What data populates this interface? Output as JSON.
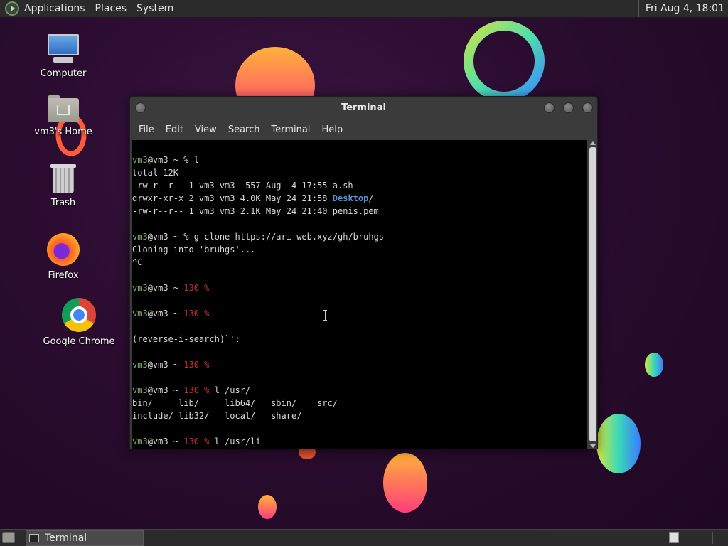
{
  "top_panel": {
    "menus": [
      "Applications",
      "Places",
      "System"
    ],
    "clock": "Fri Aug  4, 18:01"
  },
  "desktop_icons": [
    {
      "label": "Computer",
      "icon": "computer-icon"
    },
    {
      "label": "vm3's Home",
      "icon": "home-folder-icon"
    },
    {
      "label": "Trash",
      "icon": "trash-icon"
    },
    {
      "label": "Firefox",
      "icon": "firefox-icon"
    },
    {
      "label": "Google Chrome",
      "icon": "chrome-icon"
    }
  ],
  "terminal": {
    "title": "Terminal",
    "menus": [
      "File",
      "Edit",
      "View",
      "Search",
      "Terminal",
      "Help"
    ],
    "lines": [
      [
        {
          "t": "vm3",
          "c": "green"
        },
        {
          "t": "@vm3 ~ % l"
        }
      ],
      [
        {
          "t": "total 12K"
        }
      ],
      [
        {
          "t": "-rw-r--r-- 1 vm3 vm3  557 Aug  4 17:55 a.sh"
        }
      ],
      [
        {
          "t": "drwxr-xr-x 2 vm3 vm3 4.0K May 24 21:58 "
        },
        {
          "t": "Desktop",
          "c": "blue"
        },
        {
          "t": "/"
        }
      ],
      [
        {
          "t": "-rw-r--r-- 1 vm3 vm3 2.1K May 24 21:40 penis.pem"
        }
      ],
      [],
      [
        {
          "t": "vm3",
          "c": "green"
        },
        {
          "t": "@vm3 ~ % g clone https://ari-web.xyz/gh/bruhgs"
        }
      ],
      [
        {
          "t": "Cloning into 'bruhgs'..."
        }
      ],
      [
        {
          "t": "^C"
        }
      ],
      [],
      [
        {
          "t": "vm3",
          "c": "green"
        },
        {
          "t": "@vm3 ~ "
        },
        {
          "t": "130 %",
          "c": "red"
        }
      ],
      [],
      [
        {
          "t": "vm3",
          "c": "green"
        },
        {
          "t": "@vm3 ~ "
        },
        {
          "t": "130 %",
          "c": "red"
        }
      ],
      [],
      [
        {
          "t": "(reverse-i-search)`':"
        }
      ],
      [],
      [
        {
          "t": "vm3",
          "c": "green"
        },
        {
          "t": "@vm3 ~ "
        },
        {
          "t": "130 %",
          "c": "red"
        }
      ],
      [],
      [
        {
          "t": "vm3",
          "c": "green"
        },
        {
          "t": "@vm3 ~ "
        },
        {
          "t": "130 %",
          "c": "red"
        },
        {
          "t": " l /usr/"
        }
      ],
      [
        {
          "t": "bin/     lib/     lib64/   sbin/    src/"
        }
      ],
      [
        {
          "t": "include/ lib32/   local/   share/"
        }
      ],
      [],
      [
        {
          "t": "vm3",
          "c": "green"
        },
        {
          "t": "@vm3 ~ "
        },
        {
          "t": "130 %",
          "c": "red"
        },
        {
          "t": " l /usr/li"
        },
        {
          "t": " ",
          "c": "cursor"
        }
      ]
    ]
  },
  "taskbar": {
    "tasks": [
      {
        "label": "Terminal",
        "icon": "terminal-icon"
      }
    ]
  },
  "colors": {
    "prompt_user": "#7fae5e",
    "exit_code": "#c8302a",
    "directory": "#5b8fd8",
    "panel_bg": "#2b2b2b"
  }
}
